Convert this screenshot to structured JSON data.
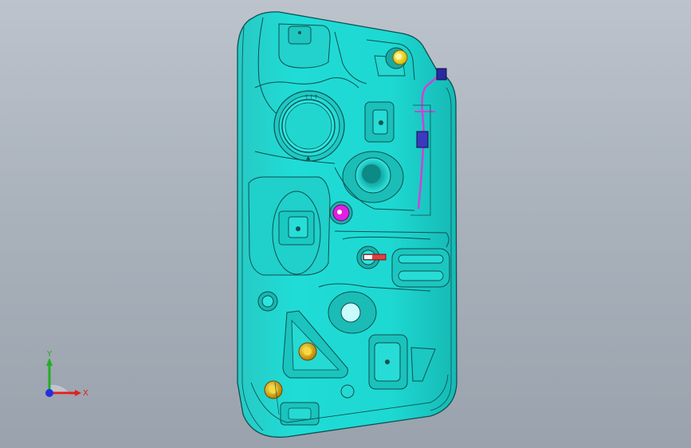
{
  "viewport": {
    "background_top": "#bcc3cc",
    "background_bottom": "#9aa2ad"
  },
  "model": {
    "body_color": "#1fd6d0",
    "edge_color": "#0d5050",
    "highlight_color": "#d8ffff",
    "fitting_yellow": "#f4dc00",
    "fitting_gold": "#d8a000",
    "fitting_magenta": "#e020e0",
    "pipe_color": "#d040d8",
    "connector_blue": "#2828a0"
  },
  "triad": {
    "x_label": "X",
    "y_label": "Y",
    "x_color": "#e02020",
    "y_color": "#20b020",
    "z_color": "#2030e0"
  }
}
